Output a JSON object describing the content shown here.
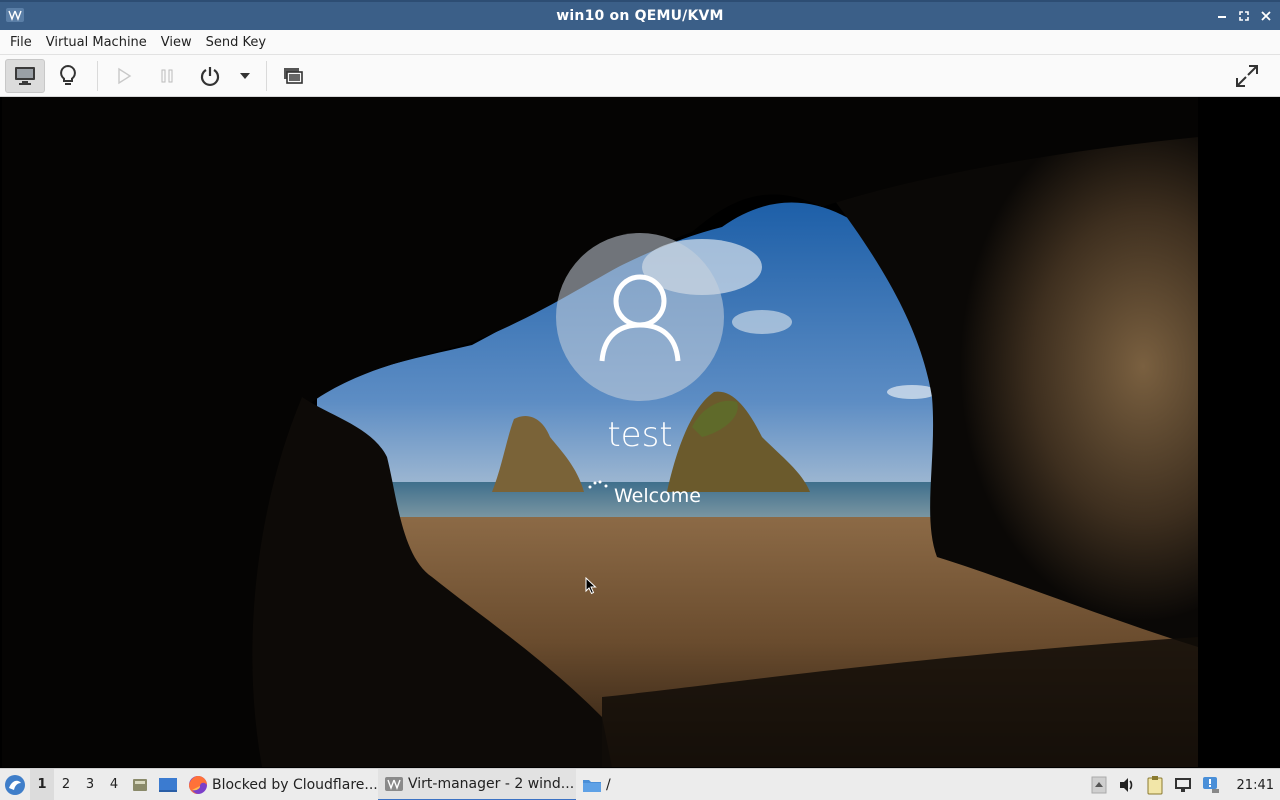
{
  "window": {
    "title": "win10 on QEMU/KVM"
  },
  "menu": [
    "File",
    "Virtual Machine",
    "View",
    "Send Key"
  ],
  "toolbar": {
    "icons": [
      "monitor-icon",
      "lightbulb-icon",
      "play-icon",
      "pause-icon",
      "power-icon",
      "dropdown-arrow-icon",
      "snapshot-icon",
      "fullscreen-icon"
    ]
  },
  "vm": {
    "user_name": "test",
    "status": "Welcome"
  },
  "taskbar": {
    "workspaces": [
      "1",
      "2",
      "3",
      "4"
    ],
    "active_workspace": "1",
    "tasks": [
      {
        "label": "Blocked by Cloudflare...",
        "icon": "firefox-icon"
      },
      {
        "label": "Virt-manager - 2 wind...",
        "icon": "virt-manager-icon"
      },
      {
        "label": "/",
        "icon": "folder-icon"
      }
    ],
    "clock": "21:41"
  },
  "colors": {
    "titlebar": "#3b5f88",
    "menubar": "#fafafa",
    "taskbar": "#ececec",
    "accent": "#3b72c4"
  }
}
